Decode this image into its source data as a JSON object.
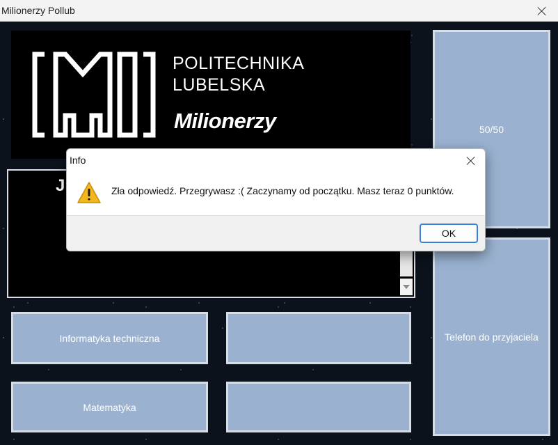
{
  "window": {
    "title": "Milionerzy Pollub"
  },
  "logo": {
    "line1": "POLITECHNIKA",
    "line2": "LUBELSKA",
    "brand": "Milionerzy"
  },
  "question": {
    "visible_text": "J"
  },
  "answers": [
    {
      "label": "Informatyka techniczna"
    },
    {
      "label": ""
    },
    {
      "label": "Matematyka"
    },
    {
      "label": ""
    }
  ],
  "lifelines": {
    "fifty_fifty": "50/50",
    "phone_friend": "Telefon do przyjaciela"
  },
  "dialog": {
    "title": "Info",
    "icon": "warning-icon",
    "message": "Zła odpowiedź. Przegrywasz :( Zaczynamy od początku. Masz teraz 0 punktów.",
    "ok_label": "OK"
  },
  "colors": {
    "button_bg": "#9ab2d0",
    "button_border": "#d7dde6",
    "warning_yellow": "#f2b81d",
    "ok_border": "#3b7fd4"
  }
}
